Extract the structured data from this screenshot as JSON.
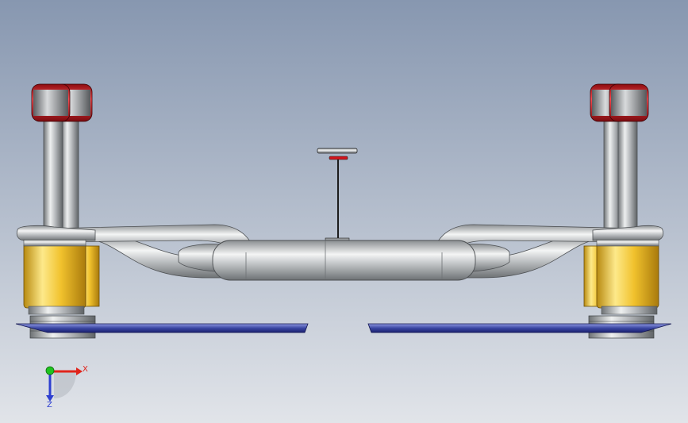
{
  "viewport": {
    "background_top": "#8797b0",
    "background_bottom": "#e1e4e9"
  },
  "model": {
    "colors": {
      "chrome": "#c9ccce",
      "chrome_dark": "#7d8184",
      "tire_red": "#d2141c",
      "tire_gray": "#a7aaad",
      "yellow_housing": "#f1c22d",
      "blue_plate": "#3a46a2",
      "stem": "#1c1c1c"
    }
  },
  "triad": {
    "x_label": "X",
    "z_label": "Z",
    "x_color": "#e0241b",
    "z_color": "#2e3fd0",
    "y_color": "#1fc41f"
  }
}
